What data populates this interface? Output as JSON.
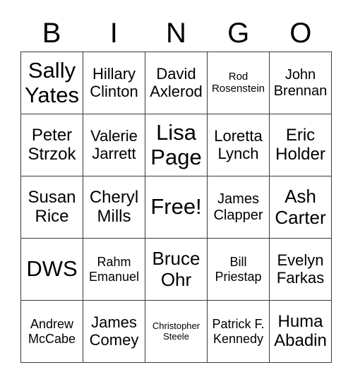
{
  "header": {
    "letters": [
      "B",
      "I",
      "N",
      "G",
      "O"
    ]
  },
  "card": {
    "rows": [
      [
        "Sally Yates",
        "Hillary Clinton",
        "David Axlerod",
        "Rod Rosenstein",
        "John Brennan"
      ],
      [
        "Peter Strzok",
        "Valerie Jarrett",
        "Lisa Page",
        "Loretta Lynch",
        "Eric Holder"
      ],
      [
        "Susan Rice",
        "Cheryl Mills",
        "Free!",
        "James Clapper",
        "Ash Carter"
      ],
      [
        "DWS",
        "Rahm Emanuel",
        "Bruce Ohr",
        "Bill Priestap",
        "Evelyn Farkas"
      ],
      [
        "Andrew McCabe",
        "James Comey",
        "Christopher Steele",
        "Patrick F. Kennedy",
        "Huma Abadin"
      ]
    ],
    "free_space": "Free!"
  },
  "colors": {
    "border": "#3a3a3a",
    "text": "#000000",
    "background": "#ffffff"
  }
}
